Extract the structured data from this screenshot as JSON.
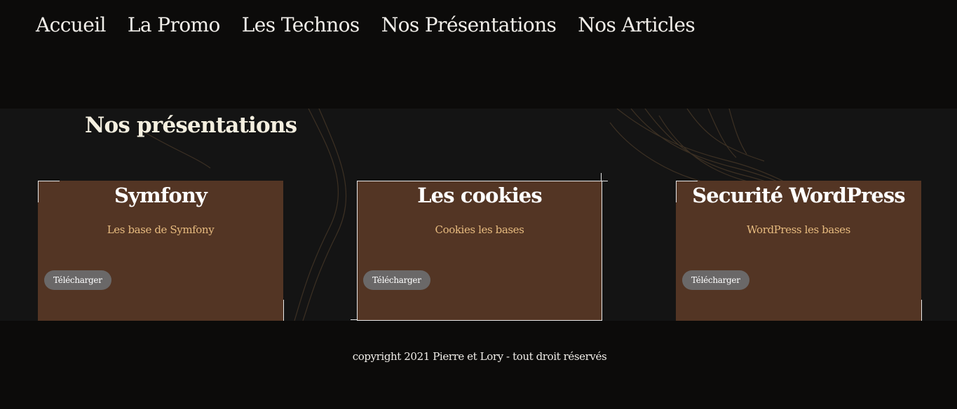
{
  "nav": {
    "items": [
      {
        "label": "Accueil"
      },
      {
        "label": "La Promo"
      },
      {
        "label": "Les Technos"
      },
      {
        "label": "Nos Présentations"
      },
      {
        "label": "Nos Articles"
      }
    ]
  },
  "main": {
    "title": "Nos présentations",
    "cards": [
      {
        "title": "Symfony",
        "description": "Les base de Symfony",
        "button_label": "Télécharger"
      },
      {
        "title": "Les cookies",
        "description": "Cookies les bases",
        "button_label": "Télécharger"
      },
      {
        "title": "Securité WordPress",
        "description": "WordPress les bases",
        "button_label": "Télécharger"
      }
    ]
  },
  "footer": {
    "copyright": "copyright 2021 Pierre et Lory - tout droit réservés"
  },
  "colors": {
    "nav_background": "#0c0b0a",
    "section_background": "#141414",
    "card_background": "#533524",
    "card_description": "#e7bb7f",
    "button_background": "#6a6868",
    "text_light": "#f1eee9"
  }
}
